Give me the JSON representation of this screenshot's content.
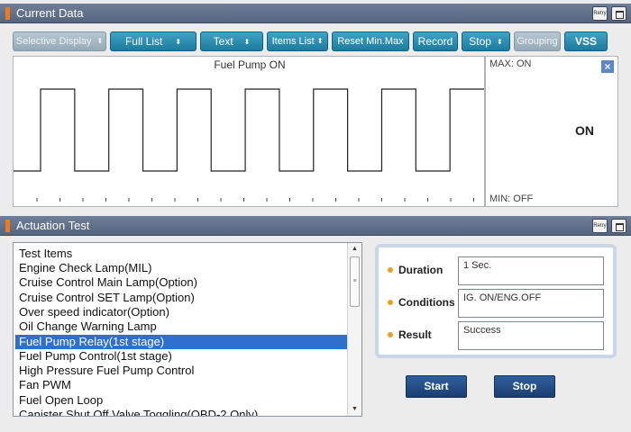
{
  "current_data": {
    "title": "Current Data",
    "toolbar": [
      {
        "label": "Selective Display",
        "has_arrow": true,
        "disabled": true
      },
      {
        "label": "Full List",
        "has_arrow": true,
        "disabled": false
      },
      {
        "label": "Text",
        "has_arrow": true,
        "disabled": false
      },
      {
        "label": "Items List",
        "has_arrow": true,
        "disabled": false
      },
      {
        "label": "Reset Min.Max",
        "has_arrow": false,
        "disabled": false
      },
      {
        "label": "Record",
        "has_arrow": false,
        "disabled": false
      },
      {
        "label": "Stop",
        "has_arrow": true,
        "disabled": false
      },
      {
        "label": "Grouping",
        "has_arrow": false,
        "disabled": true
      },
      {
        "label": "VSS",
        "has_arrow": false,
        "disabled": false
      }
    ],
    "graph": {
      "title": "Fuel Pump ON",
      "max_label": "MAX: ON",
      "min_label": "MIN: OFF",
      "current_value": "ON",
      "waveform_states": [
        "OFF",
        "ON",
        "OFF",
        "ON",
        "OFF",
        "ON",
        "OFF",
        "ON",
        "OFF",
        "ON",
        "OFF",
        "ON",
        "OFF",
        "ON"
      ]
    },
    "header_icons": [
      "retry-icon",
      "window-icon"
    ]
  },
  "actuation_test": {
    "title": "Actuation Test",
    "list_header": "Test Items",
    "items": [
      "Engine Check Lamp(MIL)",
      "Cruise Control Main Lamp(Option)",
      "Cruise Control SET Lamp(Option)",
      "Over speed indicator(Option)",
      "Oil Change Warning Lamp",
      "Fuel Pump Relay(1st stage)",
      "Fuel Pump Control(1st stage)",
      "High Pressure Fuel Pump Control",
      "Fan PWM",
      "Fuel Open Loop",
      "Canister Shut Off Valve Toggling(OBD-2 Only)"
    ],
    "selected_index": 5,
    "info": {
      "duration_label": "Duration",
      "duration_value": "1 Sec.",
      "conditions_label": "Conditions",
      "conditions_value": "IG. ON/ENG.OFF",
      "result_label": "Result",
      "result_value": "Success"
    },
    "start_label": "Start",
    "stop_label": "Stop"
  },
  "colors": {
    "header_bg": "#6f7f98",
    "accent_orange": "#f07a1a",
    "toolbar_button": "#2a8db3",
    "selection": "#2f6fce",
    "action_button": "#244c86"
  }
}
